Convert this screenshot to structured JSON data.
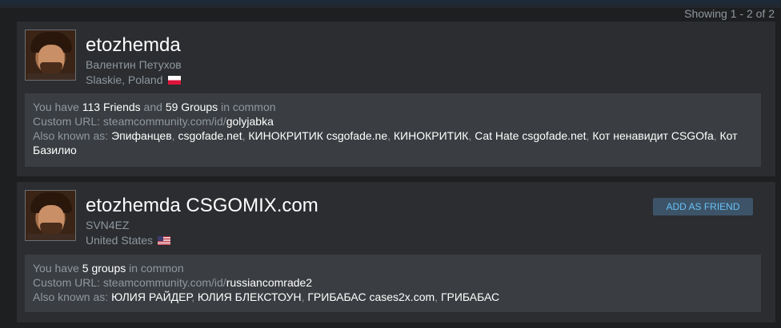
{
  "header": {
    "showing": "Showing 1 - 2 of 2"
  },
  "results": [
    {
      "name": "etozhemda",
      "real_name": "Валентин Петухов",
      "location": "Slaskie, Poland",
      "flag": "pl-flag-icon",
      "common_prefix": "You have ",
      "friends_count": "113 Friends",
      "and_text": " and ",
      "groups_count": "59 Groups",
      "common_suffix": " in common",
      "custom_url_prefix": "Custom URL: steamcommunity.com/id/",
      "custom_url_id": "golyjabka",
      "aka_label": "Also known as: ",
      "aka": [
        "Эпифанцев",
        "csgofade.net",
        "КИНОКРИТИК csgofade.ne",
        "КИНОКРИТИК",
        "Cat Hate csgofade.net",
        "Кот ненавидит CSGOfa",
        "Кот Базилио"
      ]
    },
    {
      "name": "etozhemda CSGOMIX.com",
      "real_name": "SVN4EZ",
      "location": "United States",
      "flag": "us-flag-icon",
      "add_friend_label": "ADD AS FRIEND",
      "common_prefix": "You have ",
      "groups_count": "5 groups",
      "common_suffix": " in common",
      "custom_url_prefix": "Custom URL: steamcommunity.com/id/",
      "custom_url_id": "russiancomrade2",
      "aka_label": "Also known as: ",
      "aka": [
        "ЮЛИЯ РАЙДЕР",
        "ЮЛИЯ БЛЕКСТОУН",
        "ГРИБАБАС cases2x.com",
        "ГРИБАБАС"
      ]
    }
  ]
}
